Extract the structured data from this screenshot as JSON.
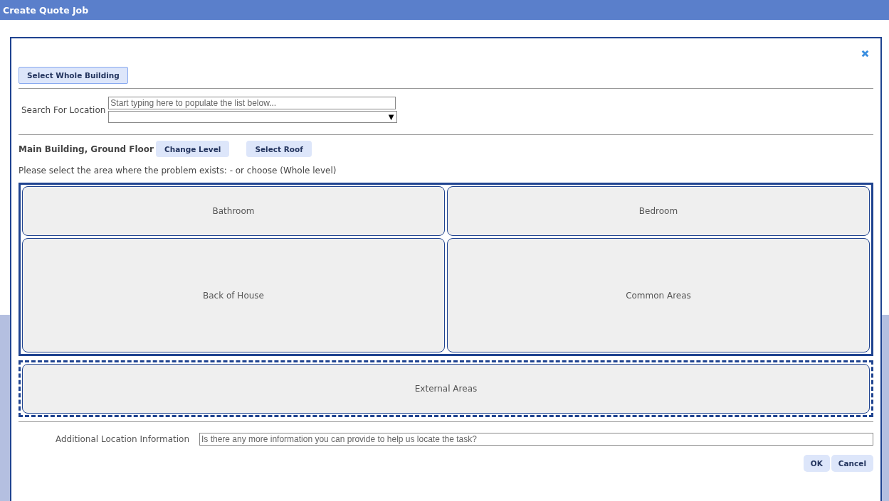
{
  "window": {
    "title": "Create Quote Job"
  },
  "select_whole_building": "Select Whole Building",
  "search": {
    "label": "Search For Location",
    "placeholder": "Start typing here to populate the list below...",
    "dropdown_arrow": "▼"
  },
  "location": {
    "title": "Main Building, Ground Floor",
    "buttons": [
      "Change Level",
      "Select Roof"
    ]
  },
  "instruction": "Please select the area where the problem exists: - or choose (Whole level)",
  "area_groups": [
    {
      "kind": "solid",
      "areas": [
        "Bathroom",
        "Bedroom",
        "Back of House",
        "Common Areas"
      ]
    },
    {
      "kind": "dashed",
      "areas": [
        "External Areas"
      ]
    }
  ],
  "additional": {
    "label": "Additional Location Information",
    "placeholder": "Is there any more information you can provide to help us locate the task?"
  },
  "buttons": [
    "OK",
    "Cancel"
  ]
}
